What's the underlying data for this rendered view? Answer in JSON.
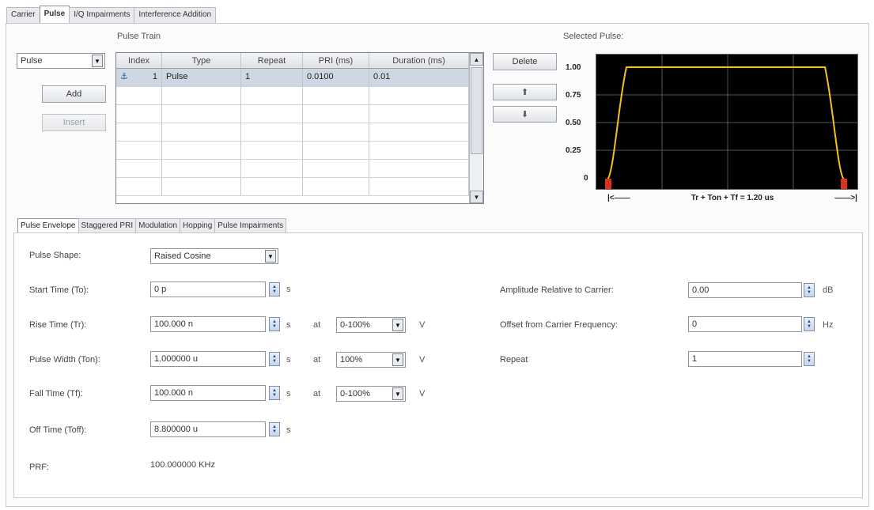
{
  "tabs": [
    "Carrier",
    "Pulse",
    "I/Q Impairments",
    "Interference Addition"
  ],
  "pulse_train": {
    "caption": "Pulse Train",
    "type_select": "Pulse",
    "add_label": "Add",
    "insert_label": "Insert",
    "delete_label": "Delete",
    "up_arrow": "⬆",
    "down_arrow": "⬇",
    "columns": [
      "Index",
      "Type",
      "Repeat",
      "PRI (ms)",
      "Duration (ms)"
    ],
    "rows": [
      {
        "index": "1",
        "type": "Pulse",
        "repeat": "1",
        "pri": "0.0100",
        "duration": "0.01"
      }
    ]
  },
  "selected_pulse": {
    "caption": "Selected Pulse:",
    "y_ticks": [
      "1.00",
      "0.75",
      "0.50",
      "0.25",
      "0"
    ],
    "x_annotation_left": "|<——",
    "x_annotation_mid": "Tr + Ton + Tf = 1.20 us",
    "x_annotation_right": "——>|"
  },
  "subtabs": [
    "Pulse Envelope",
    "Staggered PRI",
    "Modulation",
    "Hopping",
    "Pulse Impairments"
  ],
  "envelope": {
    "pulse_shape": {
      "label": "Pulse Shape:",
      "value": "Raised Cosine"
    },
    "start_time": {
      "label": "Start Time (To):",
      "value": "0 p",
      "unit": "s"
    },
    "rise_time": {
      "label": "Rise Time (Tr):",
      "value": "100.000 n",
      "unit": "s",
      "at": "at",
      "range": "0-100%",
      "vunit": "V"
    },
    "pulse_width": {
      "label": "Pulse Width (Ton):",
      "value": "1.000000 u",
      "unit": "s",
      "at": "at",
      "range": "100%",
      "vunit": "V"
    },
    "fall_time": {
      "label": "Fall Time (Tf):",
      "value": "100.000 n",
      "unit": "s",
      "at": "at",
      "range": "0-100%",
      "vunit": "V"
    },
    "off_time": {
      "label": "Off Time (Toff):",
      "value": "8.800000 u",
      "unit": "s"
    },
    "prf": {
      "label": "PRF:",
      "value": "100.000000 KHz"
    },
    "amplitude": {
      "label": "Amplitude Relative to Carrier:",
      "value": "0.00",
      "unit": "dB"
    },
    "offset": {
      "label": "Offset from Carrier Frequency:",
      "value": "0",
      "unit": "Hz"
    },
    "repeat": {
      "label": "Repeat",
      "value": "1"
    }
  }
}
